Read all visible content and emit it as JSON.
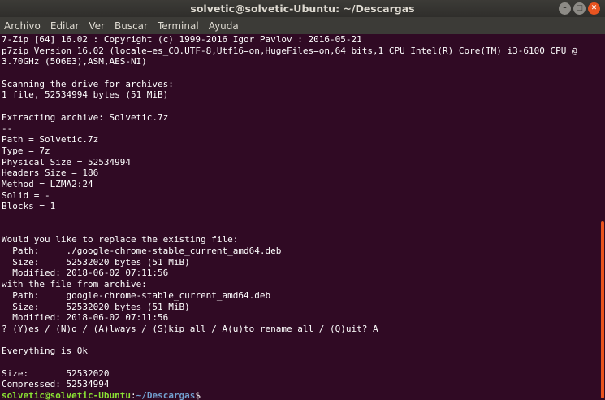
{
  "window": {
    "title": "solvetic@solvetic-Ubuntu: ~/Descargas",
    "controls": {
      "minimize": "–",
      "maximize": "□",
      "close": "✕"
    }
  },
  "menu": [
    "Archivo",
    "Editar",
    "Ver",
    "Buscar",
    "Terminal",
    "Ayuda"
  ],
  "terminal": {
    "lines": [
      "7-Zip [64] 16.02 : Copyright (c) 1999-2016 Igor Pavlov : 2016-05-21",
      "p7zip Version 16.02 (locale=es_CO.UTF-8,Utf16=on,HugeFiles=on,64 bits,1 CPU Intel(R) Core(TM) i3-6100 CPU @",
      "3.70GHz (506E3),ASM,AES-NI)",
      "",
      "Scanning the drive for archives:",
      "1 file, 52534994 bytes (51 MiB)",
      "",
      "Extracting archive: Solvetic.7z",
      "--",
      "Path = Solvetic.7z",
      "Type = 7z",
      "Physical Size = 52534994",
      "Headers Size = 186",
      "Method = LZMA2:24",
      "Solid = -",
      "Blocks = 1",
      "",
      "",
      "Would you like to replace the existing file:",
      "  Path:     ./google-chrome-stable_current_amd64.deb",
      "  Size:     52532020 bytes (51 MiB)",
      "  Modified: 2018-06-02 07:11:56",
      "with the file from archive:",
      "  Path:     google-chrome-stable_current_amd64.deb",
      "  Size:     52532020 bytes (51 MiB)",
      "  Modified: 2018-06-02 07:11:56",
      "? (Y)es / (N)o / (A)lways / (S)kip all / A(u)to rename all / (Q)uit? A",
      "",
      "Everything is Ok",
      "",
      "Size:       52532020",
      "Compressed: 52534994"
    ],
    "prompt": {
      "user_host": "solvetic@solvetic-Ubuntu",
      "separator": ":",
      "path": "~/Descargas",
      "symbol": "$"
    }
  },
  "colors": {
    "background": "#300a24",
    "prompt_user": "#8ae234",
    "prompt_path": "#729fcf",
    "scroll_thumb": "#e95420"
  }
}
